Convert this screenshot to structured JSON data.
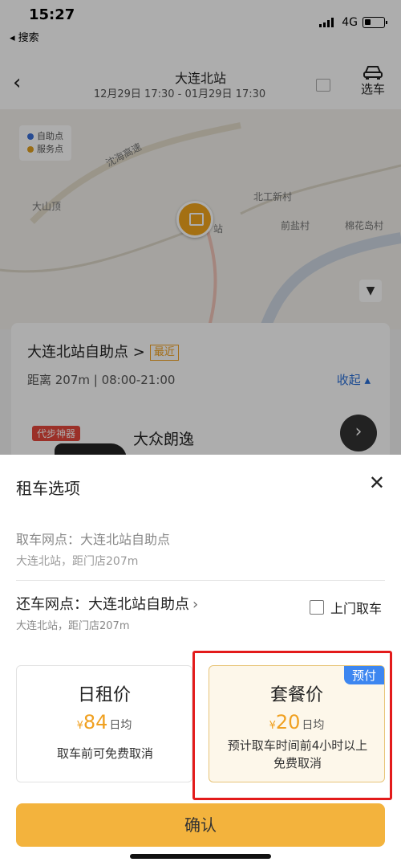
{
  "status_bar": {
    "time": "15:27",
    "back_app": "◂ 搜索",
    "network": "4G"
  },
  "nav": {
    "title": "大连北站",
    "dates": "12月29日 17:30 - 01月29日 17:30",
    "car_select_label": "选车"
  },
  "map": {
    "legend": [
      "自助点",
      "服务点"
    ],
    "legend_colors": [
      "#3a6fd8",
      "#e0a020"
    ],
    "labels": [
      "沈海高速",
      "大山顶",
      "北工新村",
      "前盐村",
      "棉花岛村",
      "站"
    ]
  },
  "store_card": {
    "title": "大连北站自助点 >",
    "tag": "最近",
    "distance_hours": "距离 207m | 08:00-21:00",
    "collapse": "收起 ▴",
    "car_badge": "代步神器",
    "car_name": "大众朗逸"
  },
  "sheet": {
    "title": "租车选项",
    "pickup_label": "取车网点：大连北站自助点",
    "pickup_sub": "大连北站，距门店207m",
    "return_label": "还车网点：大连北站自助点",
    "return_sub": "大连北站，距门店207m",
    "door_pickup": "上门取车",
    "options": [
      {
        "title": "日租价",
        "currency": "¥",
        "amount": "84",
        "unit": "日均",
        "desc": "取车前可免费取消",
        "selected": false
      },
      {
        "title": "套餐价",
        "currency": "¥",
        "amount": "20",
        "unit": "日均",
        "desc": "预计取车时间前4小时以上免费取消",
        "badge": "预付",
        "selected": true
      }
    ],
    "confirm": "确认"
  }
}
